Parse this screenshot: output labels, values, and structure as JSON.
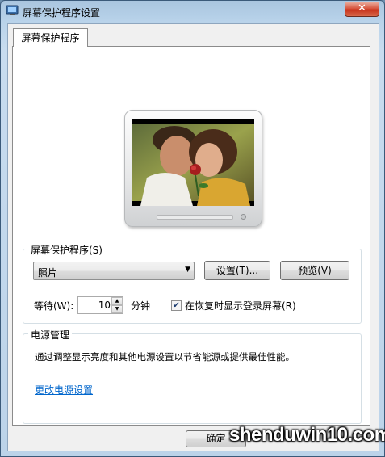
{
  "window": {
    "title": "屏幕保护程序设置",
    "close_label": "✕"
  },
  "tabs": [
    {
      "label": "屏幕保护程序"
    }
  ],
  "screensaver_group": {
    "label": "屏幕保护程序(S)",
    "selected": "照片",
    "settings_button": "设置(T)...",
    "preview_button": "预览(V)",
    "wait_label": "等待(W):",
    "wait_value": "10",
    "minutes_label": "分钟",
    "resume_checkbox_label": "在恢复时显示登录屏幕(R)",
    "resume_checked": true
  },
  "power_group": {
    "label": "电源管理",
    "description": "通过调整显示亮度和其他电源设置以节省能源或提供最佳性能。",
    "link": "更改电源设置"
  },
  "footer": {
    "ok_button": "确定"
  },
  "watermark": {
    "text": "shenduwin10.com"
  },
  "icons": {
    "app": "screensaver-icon",
    "close": "close-icon",
    "dropdown": "chevron-down-icon",
    "spin_up": "spin-up-icon",
    "spin_down": "spin-down-icon",
    "check": "checkmark-icon"
  },
  "colors": {
    "link": "#0066cc",
    "titlebar": "#b9d3ea",
    "close_button": "#d7553e"
  }
}
